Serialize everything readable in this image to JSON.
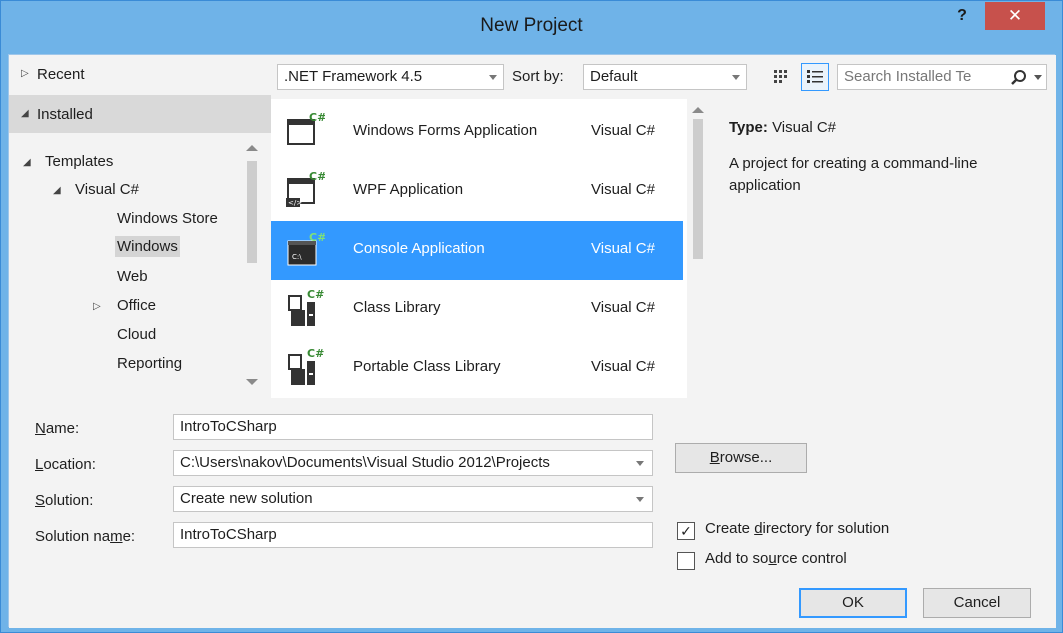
{
  "window": {
    "title": "New Project",
    "help_glyph": "?",
    "close_glyph": "✕"
  },
  "nav": {
    "recent": "Recent",
    "installed": "Installed",
    "tree": [
      {
        "label": "Templates",
        "level": 0,
        "expander": "open"
      },
      {
        "label": "Visual C#",
        "level": 1,
        "expander": "open"
      },
      {
        "label": "Windows Store",
        "level": 2,
        "expander": "none"
      },
      {
        "label": "Windows",
        "level": 2,
        "expander": "none",
        "selected": true
      },
      {
        "label": "Web",
        "level": 2,
        "expander": "none"
      },
      {
        "label": "Office",
        "level": 2,
        "expander": "closed"
      },
      {
        "label": "Cloud",
        "level": 2,
        "expander": "none"
      },
      {
        "label": "Reporting",
        "level": 2,
        "expander": "none"
      }
    ]
  },
  "toolbar": {
    "framework": ".NET Framework 4.5",
    "sort_label": "Sort by:",
    "sort_value": "Default",
    "search_placeholder": "Search Installed Te"
  },
  "templates": [
    {
      "name": "Windows Forms Application",
      "lang": "Visual C#"
    },
    {
      "name": "WPF Application",
      "lang": "Visual C#"
    },
    {
      "name": "Console Application",
      "lang": "Visual C#",
      "selected": true
    },
    {
      "name": "Class Library",
      "lang": "Visual C#"
    },
    {
      "name": "Portable Class Library",
      "lang": "Visual C#"
    }
  ],
  "details": {
    "type_label": "Type:",
    "type_value": "Visual C#",
    "description": "A project for creating a command-line application"
  },
  "form": {
    "name_label": "Name:",
    "name_value": "IntroToCSharp",
    "location_label": "Location:",
    "location_value": "C:\\Users\\nakov\\Documents\\Visual Studio 2012\\Projects",
    "solution_label": "Solution:",
    "solution_value": "Create new solution",
    "solution_name_label": "Solution name:",
    "solution_name_value": "IntroToCSharp",
    "browse_label": "Browse...",
    "create_dir_label": "Create directory for solution",
    "create_dir_checked": true,
    "source_control_label": "Add to source control",
    "source_control_checked": false,
    "ok_label": "OK",
    "cancel_label": "Cancel"
  },
  "colors": {
    "title_bar": "#6fb3e8",
    "selection": "#3399ff",
    "close": "#c7514c"
  }
}
